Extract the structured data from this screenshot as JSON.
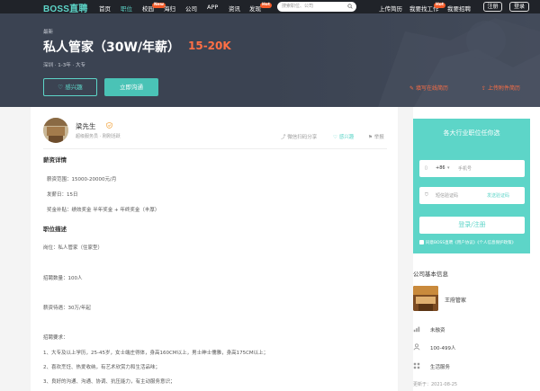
{
  "nav": {
    "logo": "BOSS直聘",
    "items": [
      {
        "label": "首页"
      },
      {
        "label": "职位"
      },
      {
        "label": "校园",
        "badge": "New"
      },
      {
        "label": "海归"
      },
      {
        "label": "公司"
      },
      {
        "label": "APP"
      },
      {
        "label": "资讯"
      },
      {
        "label": "发现",
        "badge": "Hot"
      }
    ],
    "search_placeholder": "搜索职位、公司",
    "right_links": [
      "上传简历",
      "我要找工作",
      "我要招聘"
    ],
    "right_badge": "Hot",
    "register": "注册",
    "login": "登录"
  },
  "job": {
    "tag": "最新",
    "title": "私人管家（30W/年薪）",
    "salary": "15-20K",
    "meta": "深圳 · 1-3年 · 大专",
    "interest_btn": "感兴趣",
    "chat_btn": "立即沟通",
    "upload_online": "填写在线简历",
    "upload_attachment": "上传附件简历"
  },
  "recruiter": {
    "name": "梁先生",
    "sub": "超级服务员 · 刚刚活跃",
    "actions": [
      "微信扫码分享",
      "感兴趣",
      "举报"
    ]
  },
  "detail": {
    "salary_title": "薪资详情",
    "salary_lines": [
      "薪资范围：15000-20000元/月",
      "发薪日：15日",
      "奖金补贴：绩效奖金 半年奖金 + 年终奖金（丰厚）"
    ],
    "desc_title": "职位描述",
    "desc_lines": [
      "岗位：私人管家（住家型）",
      "招聘数量：100人",
      "薪资待遇：30万/年起",
      "招聘要求：",
      "1、大专及以上学历，25-45岁，女士端庄得体，身高160CM以上，男士绅士儒雅，身高175CM以上；",
      "2、喜欢烹饪、热爱收纳，有艺术欣赏力和生活品味；",
      "3、良好的沟通、沟通、协调、抗压能力，有主动服务意识；"
    ]
  },
  "sidebar": {
    "login_title": "各大行业职位任你选",
    "phone_prefix": "+86",
    "phone_placeholder": "手机号",
    "code_placeholder": "短信验证码",
    "send_code": "发送验证码",
    "login_btn": "登录/注册",
    "agree_text": "同意BOSS直聘《用户协议》《个人信息保护政策》",
    "company_head": "公司基本信息",
    "company_name": "王府管家",
    "info": [
      {
        "icon": "financing-icon",
        "text": "未融资"
      },
      {
        "icon": "people-icon",
        "text": "100-499人"
      },
      {
        "icon": "industry-icon",
        "text": "生活服务"
      }
    ],
    "update_time": "更新于：2021-08-25"
  },
  "colors": {
    "brand": "#5dd5c8",
    "salary": "#ff6f45",
    "nav_bg": "#202329",
    "banner_bg": "#3b4352"
  }
}
